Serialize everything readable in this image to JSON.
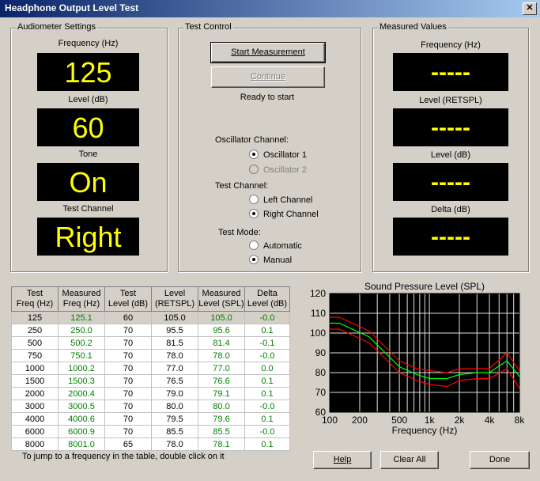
{
  "window": {
    "title": "Headphone Output Level Test",
    "close_glyph": "✕"
  },
  "audiometer": {
    "legend": "Audiometer Settings",
    "frequency_label": "Frequency (Hz)",
    "frequency_value": "125",
    "level_label": "Level (dB)",
    "level_value": "60",
    "tone_label": "Tone",
    "tone_value": "On",
    "channel_label": "Test Channel",
    "channel_value": "Right"
  },
  "control": {
    "legend": "Test Control",
    "start_label": "Start Measurement",
    "continue_label": "Continue",
    "status": "Ready to start",
    "osc_label": "Oscillator Channel:",
    "osc1": "Oscillator 1",
    "osc2": "Oscillator 2",
    "testch_label": "Test Channel:",
    "left": "Left Channel",
    "right": "Right Channel",
    "mode_label": "Test Mode:",
    "auto": "Automatic",
    "manual": "Manual"
  },
  "measured": {
    "legend": "Measured Values",
    "frequency_label": "Frequency (Hz)",
    "level_retspl_label": "Level (RETSPL)",
    "level_db_label": "Level (dB)",
    "delta_label": "Delta (dB)",
    "placeholder": "-----"
  },
  "table": {
    "headers": [
      [
        "Test",
        "Freq (Hz)"
      ],
      [
        "Measured",
        "Freq (Hz)"
      ],
      [
        "Test",
        "Level (dB)"
      ],
      [
        "Level",
        "(RETSPL)"
      ],
      [
        "Measured",
        "Level (SPL)"
      ],
      [
        "Delta",
        "Level (dB)"
      ]
    ],
    "rows": [
      [
        "125",
        "125.1",
        "60",
        "105.0",
        "105.0",
        "-0.0"
      ],
      [
        "250",
        "250.0",
        "70",
        "95.5",
        "95.6",
        "0.1"
      ],
      [
        "500",
        "500.2",
        "70",
        "81.5",
        "81.4",
        "-0.1"
      ],
      [
        "750",
        "750.1",
        "70",
        "78.0",
        "78.0",
        "-0.0"
      ],
      [
        "1000",
        "1000.2",
        "70",
        "77.0",
        "77.0",
        "0.0"
      ],
      [
        "1500",
        "1500.3",
        "70",
        "76.5",
        "76.6",
        "0.1"
      ],
      [
        "2000",
        "2000.4",
        "70",
        "79.0",
        "79.1",
        "0.1"
      ],
      [
        "3000",
        "3000.5",
        "70",
        "80.0",
        "80.0",
        "-0.0"
      ],
      [
        "4000",
        "4000.6",
        "70",
        "79.5",
        "79.6",
        "0.1"
      ],
      [
        "6000",
        "6000.9",
        "70",
        "85.5",
        "85.5",
        "-0.0"
      ],
      [
        "8000",
        "8001.0",
        "65",
        "78.0",
        "78.1",
        "0.1"
      ]
    ]
  },
  "note": "To jump to a frequency in the table, double click on it",
  "buttons": {
    "help": "Help",
    "clear_all": "Clear All",
    "done": "Done"
  },
  "colors": {
    "lcd_text": "#ffff00",
    "measured_text": "#008000",
    "trace_mid": "#00ff00",
    "trace_limits": "#ff0000"
  },
  "chart_data": {
    "type": "line",
    "title": "Sound Pressure Level (SPL)",
    "xlabel": "Frequency (Hz)",
    "ylabel": "",
    "xscale": "log",
    "xlim": [
      100,
      8000
    ],
    "ylim": [
      60,
      120
    ],
    "grid": true,
    "xticks": [
      {
        "v": 100,
        "t": "100"
      },
      {
        "v": 200,
        "t": "200"
      },
      {
        "v": 500,
        "t": "500"
      },
      {
        "v": 1000,
        "t": "1k"
      },
      {
        "v": 2000,
        "t": "2k"
      },
      {
        "v": 4000,
        "t": "4k"
      },
      {
        "v": 8000,
        "t": "8k"
      }
    ],
    "yticks": [
      60,
      70,
      80,
      90,
      100,
      110,
      120
    ],
    "x": [
      100,
      125,
      250,
      500,
      750,
      1000,
      1500,
      2000,
      3000,
      4000,
      6000,
      8000
    ],
    "series": [
      {
        "color": "#ff0000",
        "values": [
          108,
          108,
          101,
          86,
          82,
          81,
          80,
          82,
          82,
          82,
          90,
          81
        ]
      },
      {
        "color": "#00ff00",
        "values": [
          105,
          105,
          98,
          83,
          79,
          77,
          77,
          79,
          80,
          80,
          86,
          78
        ]
      },
      {
        "color": "#ff0000",
        "values": [
          102,
          102,
          95,
          80,
          76,
          74,
          73,
          76,
          77,
          77,
          82,
          72
        ]
      }
    ]
  }
}
